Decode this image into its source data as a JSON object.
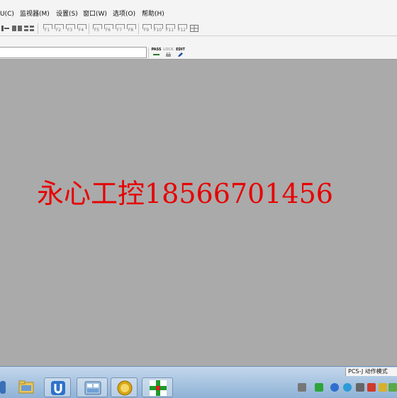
{
  "menubar": {
    "items": [
      {
        "label": "U(C)"
      },
      {
        "label": "监视器(M)"
      },
      {
        "label": "设置(S)"
      },
      {
        "label": "窗口(W)"
      },
      {
        "label": "选项(O)"
      },
      {
        "label": "帮助(H)"
      }
    ]
  },
  "toolbar": {
    "function_keys": [
      {
        "label": "F1"
      },
      {
        "label": "F2"
      },
      {
        "label": "F3"
      },
      {
        "label": "F4"
      },
      {
        "label": "F5"
      },
      {
        "label": "F6"
      },
      {
        "label": "F7"
      },
      {
        "label": "F8"
      },
      {
        "label": "F9"
      },
      {
        "label": "F10"
      },
      {
        "label": "F11"
      },
      {
        "label": "F12"
      }
    ]
  },
  "mode_buttons": [
    {
      "label": "PASS",
      "icon": "pass-line-icon",
      "color": "#2a7a2a"
    },
    {
      "label": "LOCK",
      "icon": "lock-icon",
      "color": "#999999"
    },
    {
      "label": "EDIT",
      "icon": "pencil-icon",
      "color": "#1a4aa0"
    }
  ],
  "workspace": {
    "watermark": "永心工控18566701456",
    "watermark_color": "#e60000",
    "background_color": "#aaaaaa"
  },
  "status": {
    "plc_mode": "PCS-J 动作模式"
  },
  "taskbar": {
    "apps": [
      {
        "icon": "app-icon-blue"
      },
      {
        "icon": "folder-icon"
      },
      {
        "icon": "u-shield-icon"
      },
      {
        "icon": "network-panel-icon"
      },
      {
        "icon": "fx-icon"
      },
      {
        "icon": "green-cross-app-icon"
      }
    ],
    "tray_icons": [
      {
        "icon": "battery-icon"
      },
      {
        "icon": "green-device-icon"
      },
      {
        "icon": "bluetooth-icon"
      },
      {
        "icon": "network-icon"
      },
      {
        "icon": "volume-icon"
      },
      {
        "icon": "flag-icon"
      },
      {
        "icon": "shield-check-icon"
      }
    ]
  }
}
